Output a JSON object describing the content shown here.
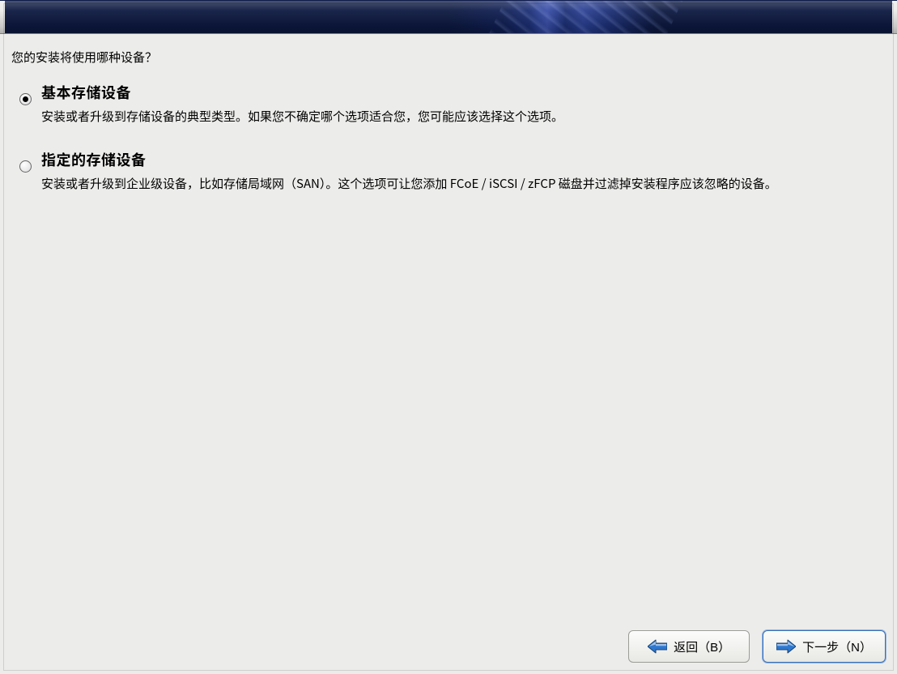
{
  "prompt": "您的安装将使用哪种设备？",
  "options": {
    "basic": {
      "title": "基本存储设备",
      "desc": "安装或者升级到存储设备的典型类型。如果您不确定哪个选项适合您，您可能应该选择这个选项。",
      "selected": true
    },
    "specialized": {
      "title": "指定的存储设备",
      "desc": "安装或者升级到企业级设备，比如存储局域网（SAN）。这个选项可让您添加 FCoE / iSCSI / zFCP 磁盘并过滤掉安装程序应该忽略的设备。",
      "selected": false
    }
  },
  "buttons": {
    "back": "返回（B）",
    "next": "下一步（N）"
  }
}
